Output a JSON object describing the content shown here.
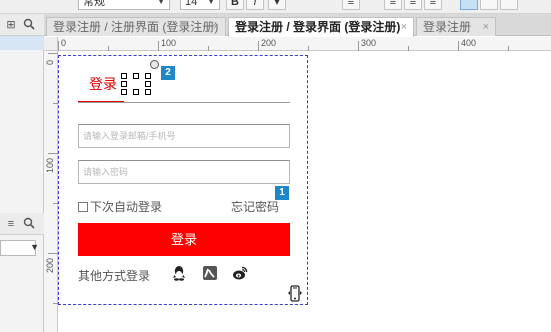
{
  "toolbar": {
    "style_select": "常规",
    "size_select": "14",
    "bold": "B",
    "italic": "I"
  },
  "tabs": [
    {
      "label": "登录注册 / 注册界面 (登录注册)",
      "close": "×"
    },
    {
      "label": "登录注册 / 登录界面 (登录注册)",
      "close": "×"
    },
    {
      "label": "登录注册",
      "close": "×"
    }
  ],
  "ruler": {
    "top_labels": [
      "0",
      "100",
      "200",
      "300",
      "400"
    ],
    "left_labels": [
      "0",
      "100",
      "200"
    ]
  },
  "form": {
    "tab_login": "登录",
    "username_placeholder": "请输入登录邮箱/手机号",
    "password_placeholder": "请输入密码",
    "remember_label": "下次自动登录",
    "forgot_label": "忘记密码",
    "login_button": "登录",
    "other_methods": "其他方式登录"
  },
  "badges": {
    "b1": "1",
    "b2": "2"
  },
  "icons": [
    "qq-icon",
    "renren-icon",
    "weibo-icon"
  ],
  "colors": {
    "brand_red": "#ff0000",
    "badge_blue": "#1e88c7"
  }
}
